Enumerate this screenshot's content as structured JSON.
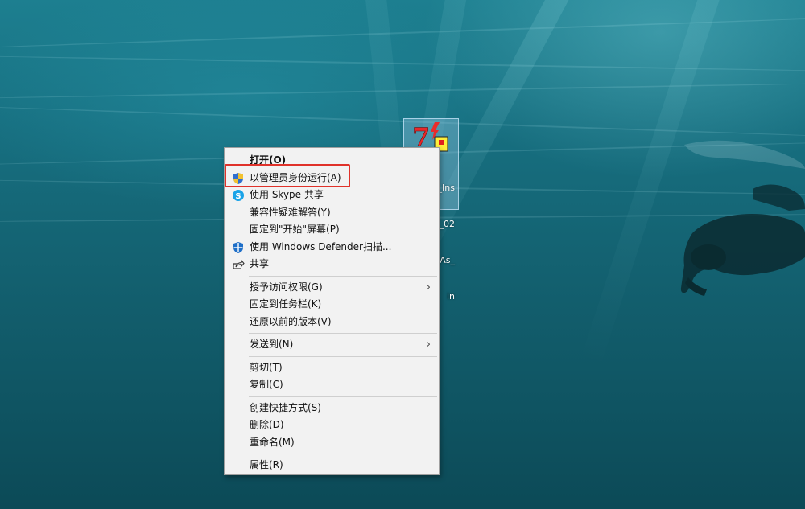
{
  "desktop_icon": {
    "label_lines": [
      "3_Ins",
      "5_02",
      "_As_",
      "in"
    ]
  },
  "context_menu": {
    "items": [
      {
        "label": "打开(O)",
        "bold": true
      },
      {
        "label": "以管理员身份运行(A)",
        "icon": "uac-shield-icon"
      },
      {
        "label": "使用 Skype 共享",
        "icon": "skype-icon"
      },
      {
        "label": "兼容性疑难解答(Y)"
      },
      {
        "label": "固定到\"开始\"屏幕(P)"
      },
      {
        "label": "使用 Windows Defender扫描...",
        "icon": "defender-icon"
      },
      {
        "label": "共享",
        "icon": "share-icon"
      },
      {
        "label": "授予访问权限(G)",
        "submenu": true
      },
      {
        "label": "固定到任务栏(K)"
      },
      {
        "label": "还原以前的版本(V)"
      },
      {
        "label": "发送到(N)",
        "submenu": true
      },
      {
        "label": "剪切(T)"
      },
      {
        "label": "复制(C)"
      },
      {
        "label": "创建快捷方式(S)"
      },
      {
        "label": "删除(D)"
      },
      {
        "label": "重命名(M)"
      },
      {
        "label": "属性(R)"
      }
    ],
    "submenu_arrow": "›"
  },
  "colors": {
    "highlight_border": "#e0322a",
    "menu_background": "#f2f2f2"
  }
}
